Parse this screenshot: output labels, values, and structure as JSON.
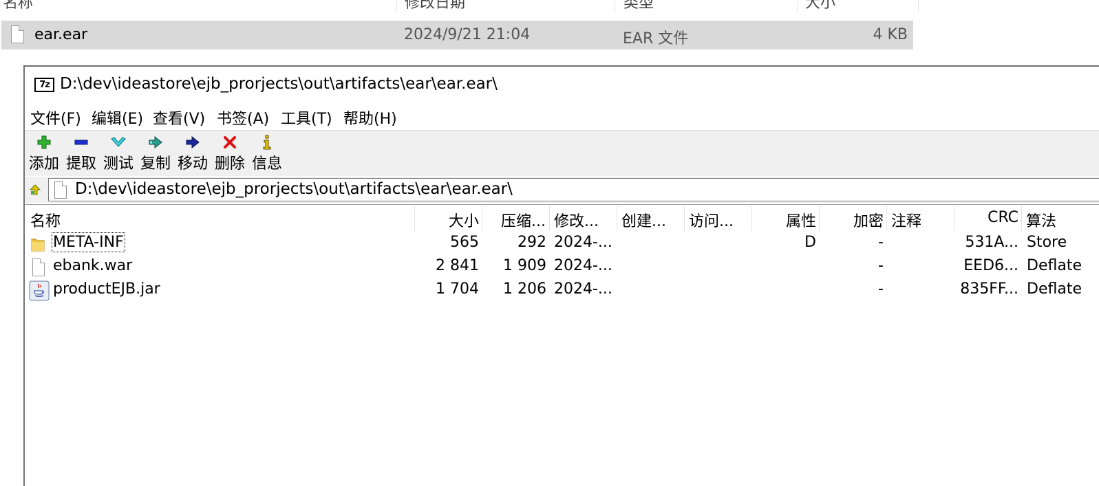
{
  "explorer": {
    "columns": [
      "名称",
      "修改日期",
      "类型",
      "大小"
    ],
    "row": {
      "name": "ear.ear",
      "modified": "2024/9/21 21:04",
      "type": "EAR 文件",
      "size": "4 KB"
    }
  },
  "window": {
    "title": "D:\\dev\\ideastore\\ejb_prorjects\\out\\artifacts\\ear\\ear.ear\\"
  },
  "menu": [
    {
      "label": "文件(F)"
    },
    {
      "label": "编辑(E)"
    },
    {
      "label": "查看(V)"
    },
    {
      "label": "书签(A)"
    },
    {
      "label": "工具(T)"
    },
    {
      "label": "帮助(H)"
    }
  ],
  "toolbar": [
    {
      "label": "添加",
      "icon": "plus-icon",
      "color": "#1a9c1a"
    },
    {
      "label": "提取",
      "icon": "minus-icon",
      "color": "#1a2fd4"
    },
    {
      "label": "测试",
      "icon": "check-icon",
      "color": "#18b8c8"
    },
    {
      "label": "复制",
      "icon": "copy-arrow-icon",
      "color": "#1a8a7a"
    },
    {
      "label": "移动",
      "icon": "move-arrow-icon",
      "color": "#1a2a8c"
    },
    {
      "label": "删除",
      "icon": "delete-x-icon",
      "color": "#e01010"
    },
    {
      "label": "信息",
      "icon": "info-icon",
      "color": "#c8a800"
    }
  ],
  "address": {
    "path": "D:\\dev\\ideastore\\ejb_prorjects\\out\\artifacts\\ear\\ear.ear\\"
  },
  "list": {
    "headers": {
      "name": "名称",
      "size": "大小",
      "packed": "压缩...",
      "modified": "修改...",
      "created": "创建...",
      "accessed": "访问...",
      "attributes": "属性",
      "encrypted": "加密",
      "comment": "注释",
      "crc": "CRC",
      "method": "算法"
    },
    "rows": [
      {
        "name": "META-INF",
        "icon": "folder-icon",
        "size": "565",
        "packed": "292",
        "modified": "2024-...",
        "attributes": "D",
        "encrypted": "-",
        "crc": "531A...",
        "method": "Store"
      },
      {
        "name": "ebank.war",
        "icon": "file-icon",
        "size": "2 841",
        "packed": "1 909",
        "modified": "2024-...",
        "attributes": "",
        "encrypted": "-",
        "crc": "EED6...",
        "method": "Deflate"
      },
      {
        "name": "productEJB.jar",
        "icon": "java-icon",
        "size": "1 704",
        "packed": "1 206",
        "modified": "2024-...",
        "attributes": "",
        "encrypted": "-",
        "crc": "835FF...",
        "method": "Deflate"
      }
    ]
  }
}
